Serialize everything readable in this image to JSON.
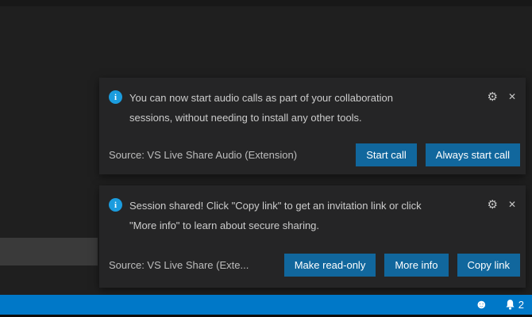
{
  "colors": {
    "page_background": "#1f1f1f",
    "toast_background": "#252526",
    "button_accent": "#11679d",
    "status_bar_blue": "#0078c8",
    "info_icon_blue": "#1b9cde",
    "body_text": "#cccccc"
  },
  "icons": {
    "info": "i",
    "gear": "⚙",
    "close": "✕",
    "smiley": "☻",
    "bell": "bell-shape"
  },
  "notifications": [
    {
      "message_line1": "You can now start audio calls as part of your collaboration",
      "message_line2": "sessions, without needing to install any other tools.",
      "source": "Source: VS Live Share Audio (Extension)",
      "buttons": {
        "start_call": "Start call",
        "always_start_call": "Always start call"
      }
    },
    {
      "message_line1": "Session shared! Click \"Copy link\" to get an invitation link or click",
      "message_line2": "\"More info\" to learn about secure sharing.",
      "source": "Source: VS Live Share (Exte...",
      "buttons": {
        "make_read_only": "Make read-only",
        "more_info": "More info",
        "copy_link": "Copy link"
      }
    }
  ],
  "status_bar": {
    "notification_count": "2"
  }
}
